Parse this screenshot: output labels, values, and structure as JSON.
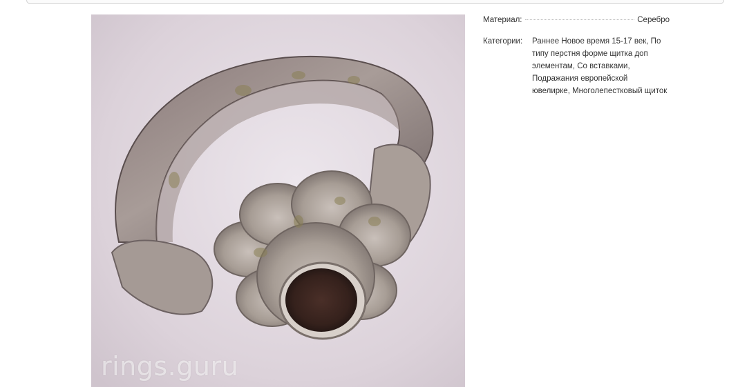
{
  "photo": {
    "watermark": "rings.guru"
  },
  "properties": {
    "material_label": "Материал:",
    "material_value": "Серебро",
    "categories_label": "Категории:",
    "categories_text": "Раннее Новое время 15-17 век, По типу перстня форме щитка доп элементам, Со вставками, Подражания европейской ювелирке, Многолепестковый щиток"
  }
}
